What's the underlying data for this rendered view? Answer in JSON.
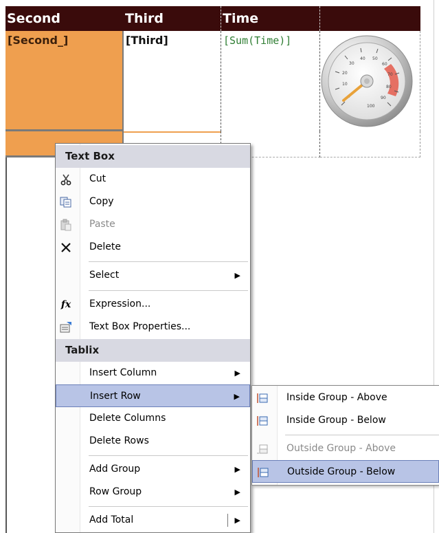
{
  "tablix": {
    "headers": [
      "Second",
      "Third",
      "Time"
    ],
    "cells": [
      "[Second_]",
      "[Third]",
      "[Sum(Time)]"
    ],
    "gauge_icon": "radial-gauge-icon"
  },
  "context_menu": {
    "section_textbox": "Text Box",
    "section_tablix": "Tablix",
    "items": {
      "cut": "Cut",
      "copy": "Copy",
      "paste": "Paste",
      "delete": "Delete",
      "select": "Select",
      "expression": "Expression...",
      "textbox_properties": "Text Box Properties...",
      "insert_column": "Insert Column",
      "insert_row": "Insert Row",
      "delete_columns": "Delete Columns",
      "delete_rows": "Delete Rows",
      "add_group": "Add Group",
      "row_group": "Row Group",
      "add_total": "Add Total"
    },
    "icons": {
      "cut": "scissors-icon",
      "copy": "copy-icon",
      "paste": "paste-icon",
      "delete": "delete-x-icon",
      "expression": "fx-icon",
      "properties": "properties-icon"
    }
  },
  "submenu": {
    "items": {
      "inside_above": "Inside Group - Above",
      "inside_below": "Inside Group - Below",
      "outside_above": "Outside Group - Above",
      "outside_below": "Outside Group - Below"
    }
  },
  "colors": {
    "header_bg": "#3a0b0b",
    "highlight": "#b8c4e6",
    "orange_cell": "#ef9f4f"
  }
}
